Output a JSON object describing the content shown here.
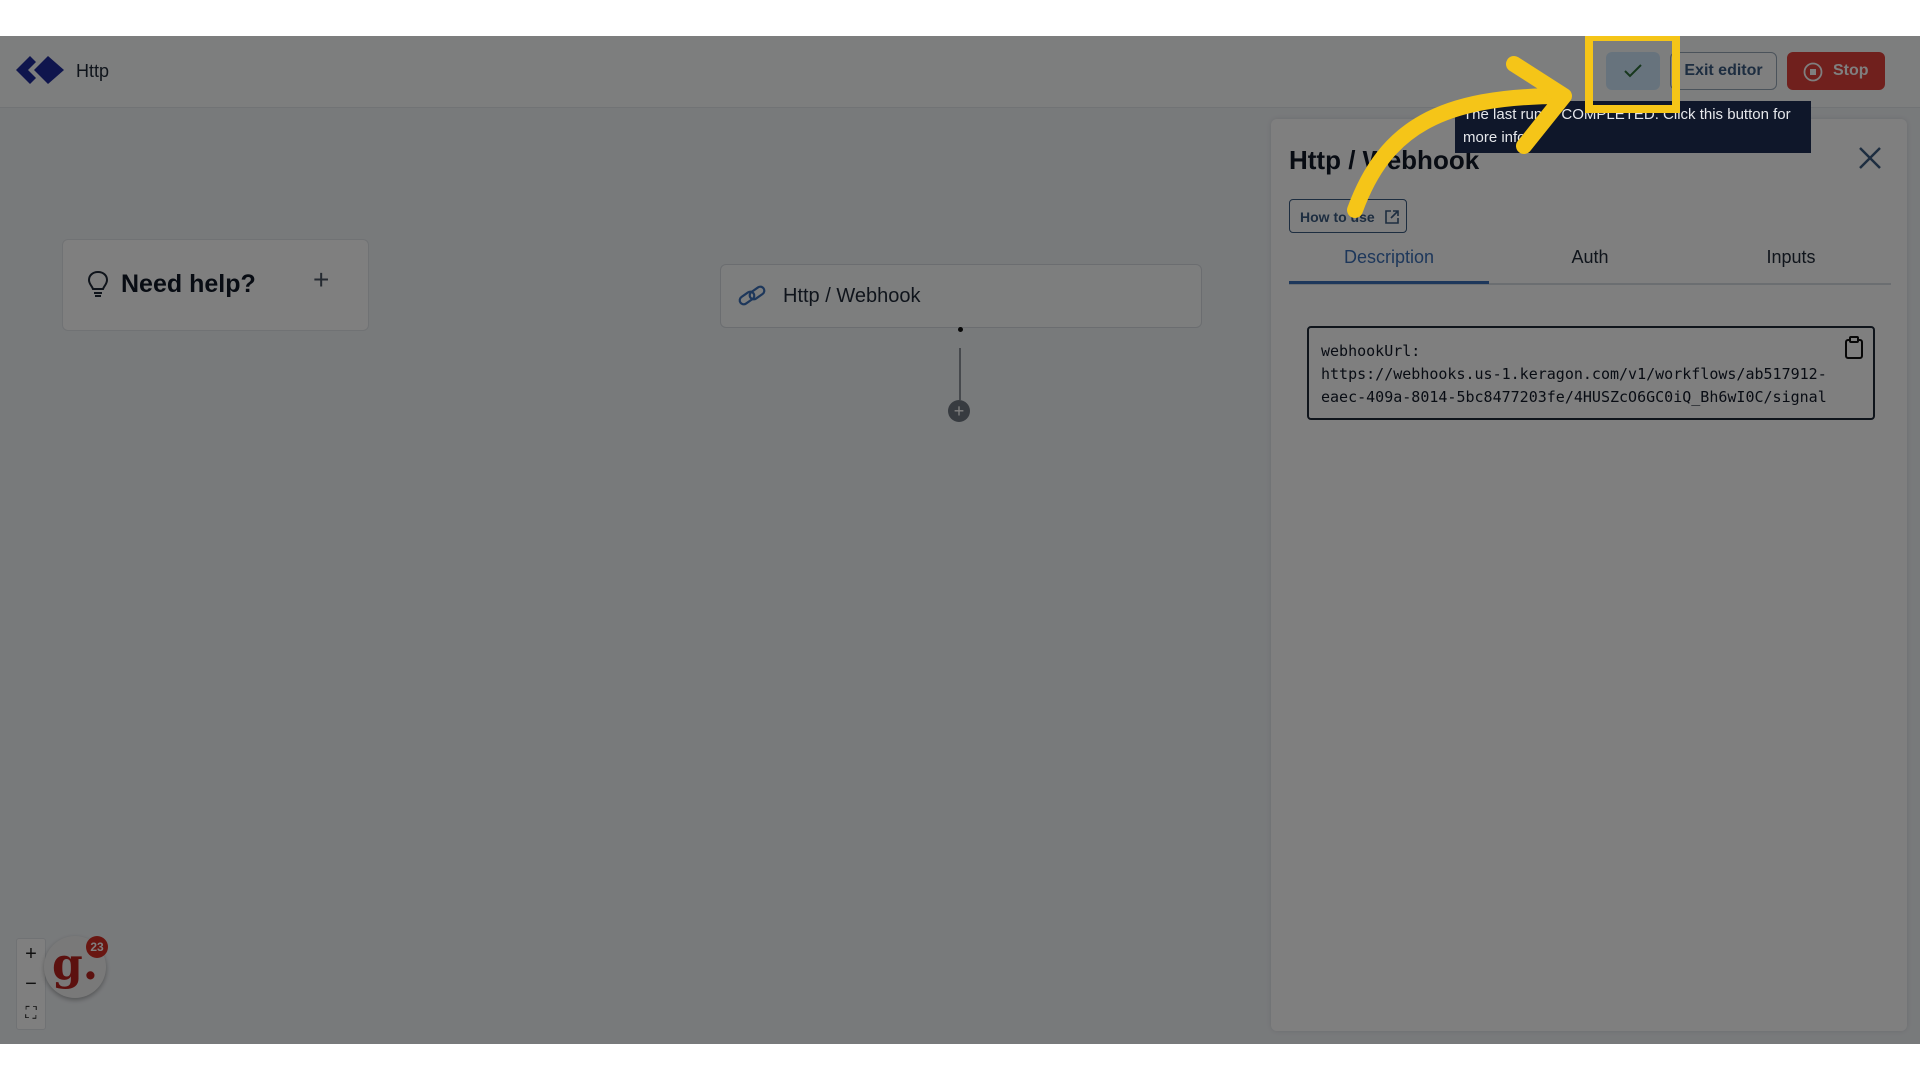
{
  "header": {
    "app_title": "Http",
    "exit_label": "Exit editor",
    "stop_label": "Stop",
    "status_tooltip": "The last run is COMPLETED. Click this button for more info."
  },
  "help": {
    "title": "Need help?",
    "plus": "+"
  },
  "canvas": {
    "node_title": "Http / Webhook",
    "add_step": "+"
  },
  "panel": {
    "title": "Http / Webhook",
    "how_to_use": "How to use",
    "tabs": [
      {
        "label": "Description",
        "active": true
      },
      {
        "label": "Auth",
        "active": false
      },
      {
        "label": "Inputs",
        "active": false
      }
    ],
    "code_label": "webhookUrl:",
    "code_line_1": "https://webhooks.us-1.keragon.com/v1/workflows/ab517912-",
    "code_line_2": "eaec-409a-8014-5bc8477203fe/4HUSZcO6GC0iQ_Bh6wI0C/signal"
  },
  "zoom": {
    "in": "+",
    "out": "−",
    "fit": "⛶"
  },
  "badge": {
    "letter": "g.",
    "count": "23"
  },
  "colors": {
    "accent": "#3b6fb6",
    "stop": "#e0403a",
    "highlight": "#f5c518",
    "check_bg": "#cfe7fb"
  }
}
